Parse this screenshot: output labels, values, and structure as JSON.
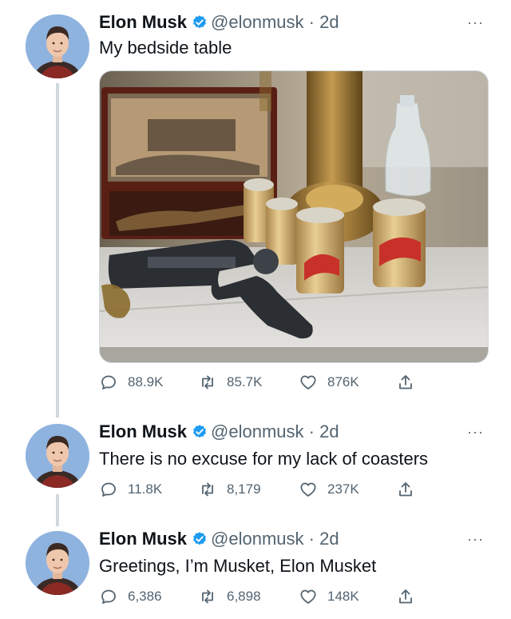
{
  "tweets": [
    {
      "author_name": "Elon Musk",
      "handle": "@elonmusk",
      "separator": "·",
      "time": "2d",
      "text": "My bedside table",
      "has_photo": true,
      "replies": "88.9K",
      "retweets": "85.7K",
      "likes": "876K"
    },
    {
      "author_name": "Elon Musk",
      "handle": "@elonmusk",
      "separator": "·",
      "time": "2d",
      "text": "There is no excuse for my lack of coasters",
      "replies": "11.8K",
      "retweets": "8,179",
      "likes": "237K"
    },
    {
      "author_name": "Elon Musk",
      "handle": "@elonmusk",
      "separator": "·",
      "time": "2d",
      "text": "Greetings, I’m Musket, Elon Musket",
      "replies": "6,386",
      "retweets": "6,898",
      "likes": "148K"
    }
  ],
  "more_glyph": "···",
  "colors": {
    "verified": "#1d9bf0",
    "muted": "#536471",
    "thread_line": "#cfd9de"
  },
  "icons": [
    "verified-badge-icon",
    "reply-icon",
    "retweet-icon",
    "like-icon",
    "share-icon",
    "more-icon"
  ]
}
